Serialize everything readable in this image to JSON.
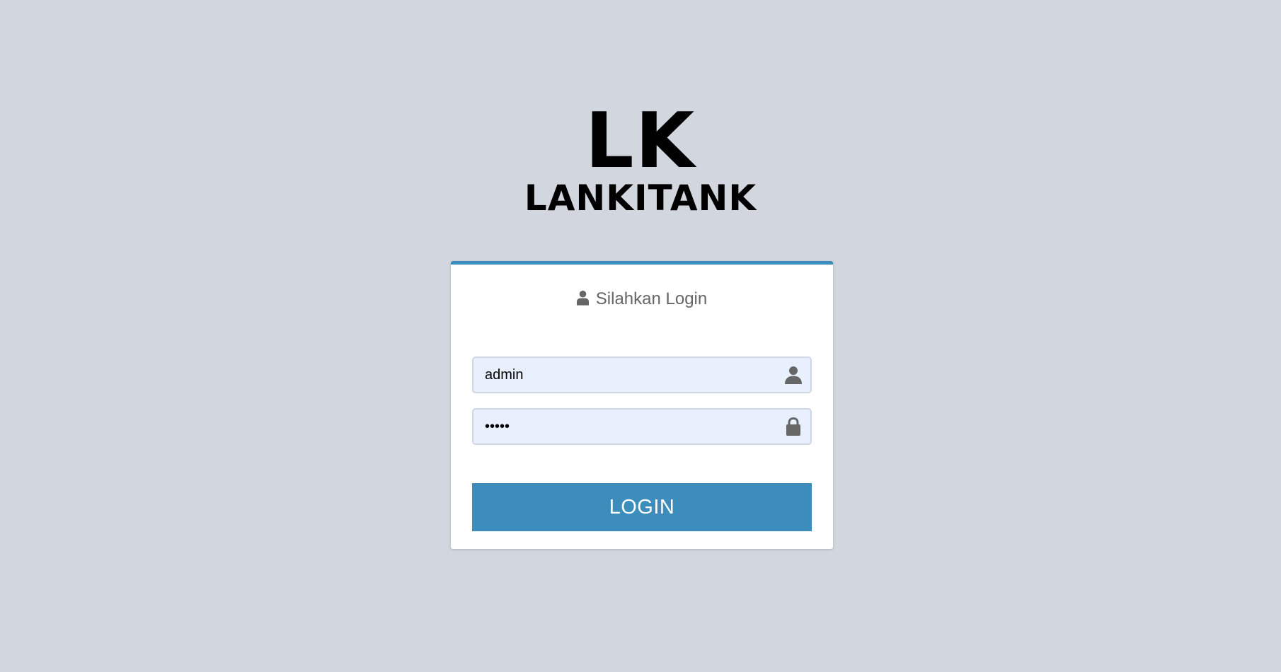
{
  "brand": {
    "mark": "LK",
    "name": "LANKITANK"
  },
  "login_box": {
    "title": "Silahkan Login",
    "title_icon": "user-icon",
    "username": {
      "value": "admin",
      "icon": "user-icon"
    },
    "password": {
      "value": "admin",
      "icon": "lock-icon"
    },
    "submit_label": "LOGIN"
  },
  "colors": {
    "background": "#d2d6de",
    "accent": "#3c8dbc",
    "input_fill": "#e8f0fe",
    "icon": "#666666"
  }
}
